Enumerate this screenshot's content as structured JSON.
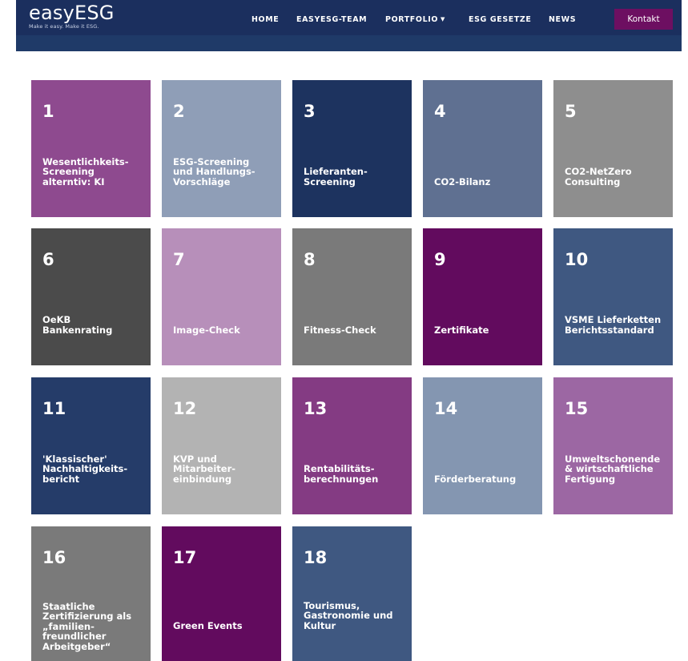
{
  "brand": {
    "name": "easyESG",
    "tagline": "Make it easy. Make it ESG."
  },
  "nav": {
    "items": [
      {
        "label": "HOME"
      },
      {
        "label": "EASYESG-TEAM"
      },
      {
        "label": "PORTFOLIO",
        "dropdown_icon": "caret-down-icon"
      },
      {
        "label": "ESG GESETZE"
      },
      {
        "label": "NEWS"
      }
    ],
    "contact_label": "Kontakt"
  },
  "colors": {
    "header": "#1b2f5e",
    "accent": "#6d0f61"
  },
  "tiles": [
    {
      "number": "1",
      "title": "Wesentlichkeits-\nScreening\nalterntiv: KI",
      "color": "#8e4a8f"
    },
    {
      "number": "2",
      "title": "ESG-Screening\nund Handlungs-\nVorschläge",
      "color": "#8f9eb7"
    },
    {
      "number": "3",
      "title": "Lieferanten-\nScreening",
      "color": "#1d335f"
    },
    {
      "number": "4",
      "title": "CO2-Bilanz",
      "color": "#5f7091"
    },
    {
      "number": "5",
      "title": "CO2-NetZero\nConsulting",
      "color": "#8e8e8e"
    },
    {
      "number": "6",
      "title": "OeKB\nBankenrating",
      "color": "#4b4b4b"
    },
    {
      "number": "7",
      "title": "Image-Check",
      "color": "#b78fba"
    },
    {
      "number": "8",
      "title": "Fitness-Check",
      "color": "#7a7a7a"
    },
    {
      "number": "9",
      "title": "Zertifikate",
      "color": "#620b5e"
    },
    {
      "number": "10",
      "title": "VSME Lieferketten\nBerichtsstandard",
      "color": "#3f5881"
    },
    {
      "number": "11",
      "title": "'Klassischer'\nNachhaltigkeits-\nbericht",
      "color": "#253c69"
    },
    {
      "number": "12",
      "title": "KVP und\nMitarbeiter-\neinbindung",
      "color": "#b3b3b3"
    },
    {
      "number": "13",
      "title": "Rentabilitäts-\nberechnungen",
      "color": "#843b83"
    },
    {
      "number": "14",
      "title": "Förderberatung",
      "color": "#8496b1"
    },
    {
      "number": "15",
      "title": "Umweltschonende\n& wirtschaftliche\nFertigung",
      "color": "#9c67a3"
    },
    {
      "number": "16",
      "title": "Staatliche\nZertifizierung als\n„familien-\nfreundlicher\nArbeitgeber“",
      "color": "#7a7a7a"
    },
    {
      "number": "17",
      "title": "Green Events",
      "color": "#620b5e"
    },
    {
      "number": "18",
      "title": "Tourismus,\nGastronomie und\nKultur",
      "color": "#3f5881"
    }
  ]
}
